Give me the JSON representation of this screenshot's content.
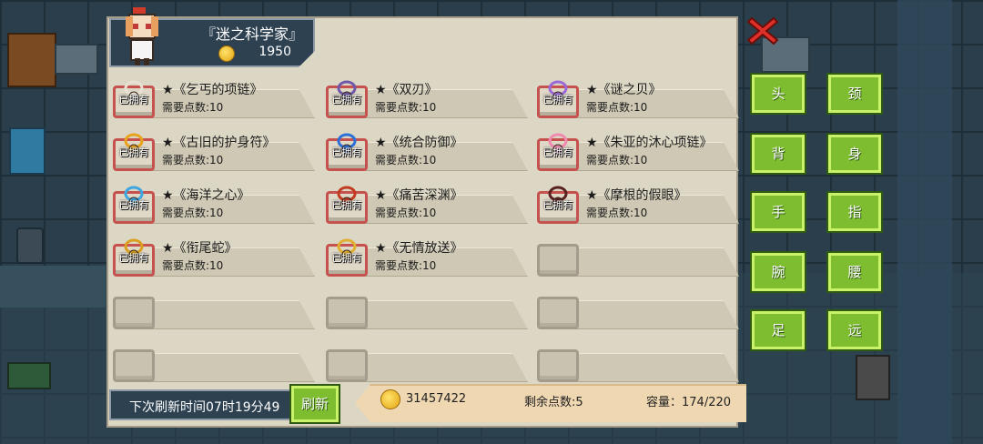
{
  "shop": {
    "title": "『迷之科学家』",
    "coins": "1950"
  },
  "items": [
    {
      "name": "★《乞丐的项链》",
      "cost": "需要点数:10",
      "owned_label": "已拥有",
      "icon": "necklace-icon",
      "color": "#e9e2d4"
    },
    {
      "name": "★《双刃》",
      "cost": "需要点数:10",
      "owned_label": "已拥有",
      "icon": "twin-blade-icon",
      "color": "#6e5aa8"
    },
    {
      "name": "★《谜之贝》",
      "cost": "需要点数:10",
      "owned_label": "已拥有",
      "icon": "shell-icon",
      "color": "#9a6bd6"
    },
    {
      "name": "★《古旧的护身符》",
      "cost": "需要点数:10",
      "owned_label": "已拥有",
      "icon": "amulet-icon",
      "color": "#e8a31d"
    },
    {
      "name": "★《统合防御》",
      "cost": "需要点数:10",
      "owned_label": "已拥有",
      "icon": "gem-necklace-icon",
      "color": "#2c6fd6"
    },
    {
      "name": "★《朱亚的沐心项链》",
      "cost": "需要点数:10",
      "owned_label": "已拥有",
      "icon": "heart-necklace-icon",
      "color": "#f08ab0"
    },
    {
      "name": "★《海洋之心》",
      "cost": "需要点数:10",
      "owned_label": "已拥有",
      "icon": "ocean-heart-icon",
      "color": "#3ea6e0"
    },
    {
      "name": "★《痛苦深渊》",
      "cost": "需要点数:10",
      "owned_label": "已拥有",
      "icon": "abyss-icon",
      "color": "#c23a1e"
    },
    {
      "name": "★《摩根的假眼》",
      "cost": "需要点数:10",
      "owned_label": "已拥有",
      "icon": "false-eye-icon",
      "color": "#5a2020"
    },
    {
      "name": "★《衔尾蛇》",
      "cost": "需要点数:10",
      "owned_label": "已拥有",
      "icon": "ouroboros-icon",
      "color": "#d9a020"
    },
    {
      "name": "★《无情放送》",
      "cost": "需要点数:10",
      "owned_label": "已拥有",
      "icon": "broadcast-icon",
      "color": "#e0b030"
    }
  ],
  "footer": {
    "refresh_text": "下次刷新时间07时19分49",
    "refresh_button": "刷新",
    "gold": "31457422",
    "points_left": "剩余点数:5",
    "capacity": "容量：174/220"
  },
  "categories": [
    "头",
    "颈",
    "背",
    "身",
    "手",
    "指",
    "腕",
    "腰",
    "足",
    "远"
  ],
  "colors": {
    "accent_green": "#7ebd2f",
    "owned_border": "#c5524f",
    "close_red": "#e0302a"
  }
}
